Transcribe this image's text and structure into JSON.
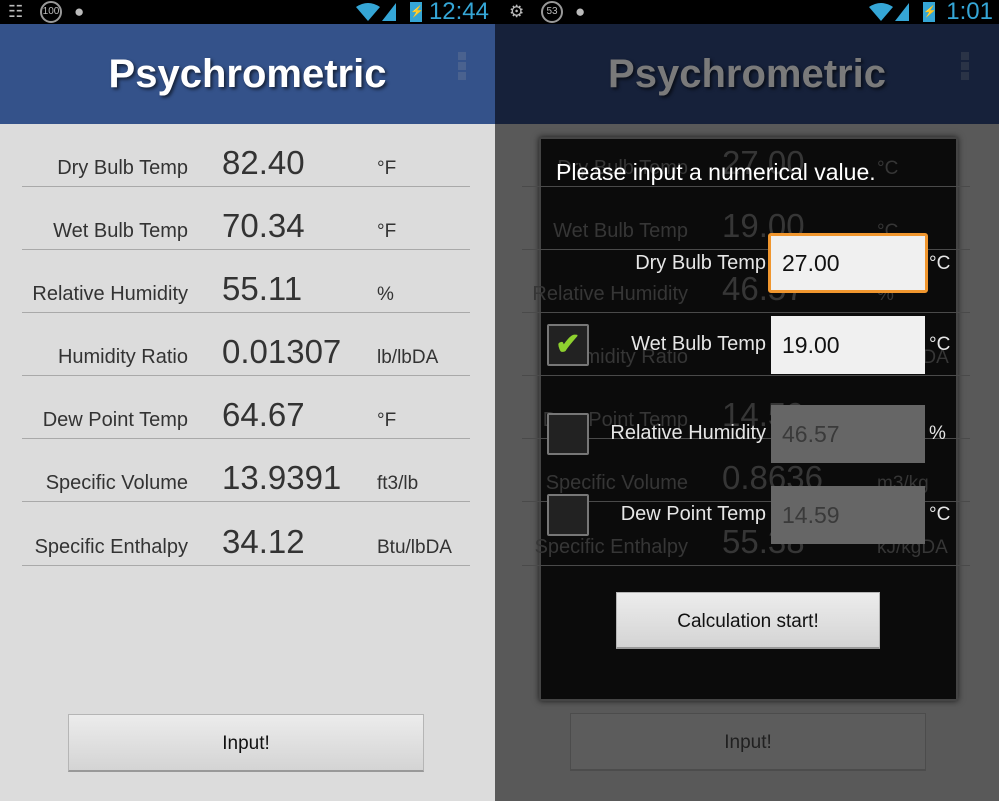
{
  "left": {
    "status": {
      "notification_count": "100",
      "time": "12:44"
    },
    "title": "Psychrometric",
    "rows": [
      {
        "label": "Dry Bulb Temp",
        "value": "82.40",
        "unit": "°F"
      },
      {
        "label": "Wet Bulb Temp",
        "value": "70.34",
        "unit": "°F"
      },
      {
        "label": "Relative Humidity",
        "value": "55.11",
        "unit": "%"
      },
      {
        "label": "Humidity Ratio",
        "value": "0.01307",
        "unit": "lb/lbDA"
      },
      {
        "label": "Dew Point Temp",
        "value": "64.67",
        "unit": "°F"
      },
      {
        "label": "Specific Volume",
        "value": "13.9391",
        "unit": "ft3/lb"
      },
      {
        "label": "Specific Enthalpy",
        "value": "34.12",
        "unit": "Btu/lbDA"
      }
    ],
    "input_button": "Input!"
  },
  "right": {
    "status": {
      "notification_count": "53",
      "time": "1:01"
    },
    "title": "Psychrometric",
    "rows": [
      {
        "label": "Dry Bulb Temp",
        "value": "27.00",
        "unit": "°C"
      },
      {
        "label": "Wet Bulb Temp",
        "value": "19.00",
        "unit": "°C"
      },
      {
        "label": "Relative Humidity",
        "value": "46.57",
        "unit": "%"
      },
      {
        "label": "Humidity Ratio",
        "unit": "kg/kgDA"
      },
      {
        "label": "Dew Point Temp",
        "value": "14.59",
        "unit": "°C"
      },
      {
        "label": "Specific Volume",
        "value": "0.8636",
        "unit": "m3/kg"
      },
      {
        "label": "Specific Enthalpy",
        "value": "55.38",
        "unit": "kJ/kgDA"
      }
    ],
    "input_button": "Input!",
    "dialog": {
      "title": "Please input a numerical value.",
      "fields": [
        {
          "label": "Dry Bulb Temp",
          "value": "27.00",
          "unit": "°C",
          "focused": true
        },
        {
          "label": "Wet Bulb Temp",
          "value": "19.00",
          "unit": "°C",
          "checked": true
        },
        {
          "label": "Relative Humidity",
          "value": "46.57",
          "unit": "%",
          "checked": false
        },
        {
          "label": "Dew Point Temp",
          "value": "14.59",
          "unit": "°C",
          "checked": false
        }
      ],
      "submit_button": "Calculation start!"
    }
  },
  "colors": {
    "header": "#34528a",
    "accent_status": "#35a6d6",
    "focus": "#f0962e",
    "check": "#8ed12f"
  }
}
